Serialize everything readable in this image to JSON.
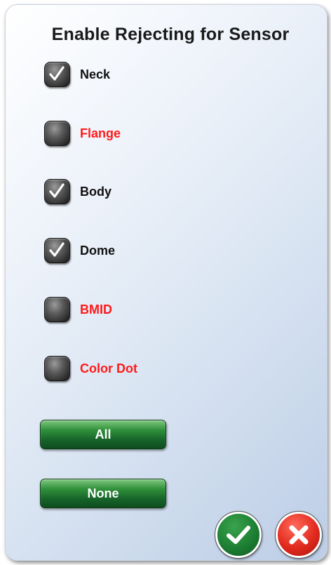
{
  "dialog": {
    "title": "Enable Rejecting for Sensor"
  },
  "options": [
    {
      "label": "Neck",
      "checked": true,
      "color": "#111111"
    },
    {
      "label": "Flange",
      "checked": false,
      "color": "#ff1a1a"
    },
    {
      "label": "Body",
      "checked": true,
      "color": "#111111"
    },
    {
      "label": "Dome",
      "checked": true,
      "color": "#111111"
    },
    {
      "label": "BMID",
      "checked": false,
      "color": "#ff1a1a"
    },
    {
      "label": "Color Dot",
      "checked": false,
      "color": "#ff1a1a"
    }
  ],
  "buttons": {
    "all_label": "All",
    "none_label": "None",
    "ok_icon": "checkmark-icon",
    "cancel_icon": "x-icon"
  },
  "colors": {
    "button_green": "#17632a",
    "ok_green": "#1d7f33",
    "cancel_red": "#e22a1e",
    "disabled_label_red": "#ff1a1a"
  }
}
